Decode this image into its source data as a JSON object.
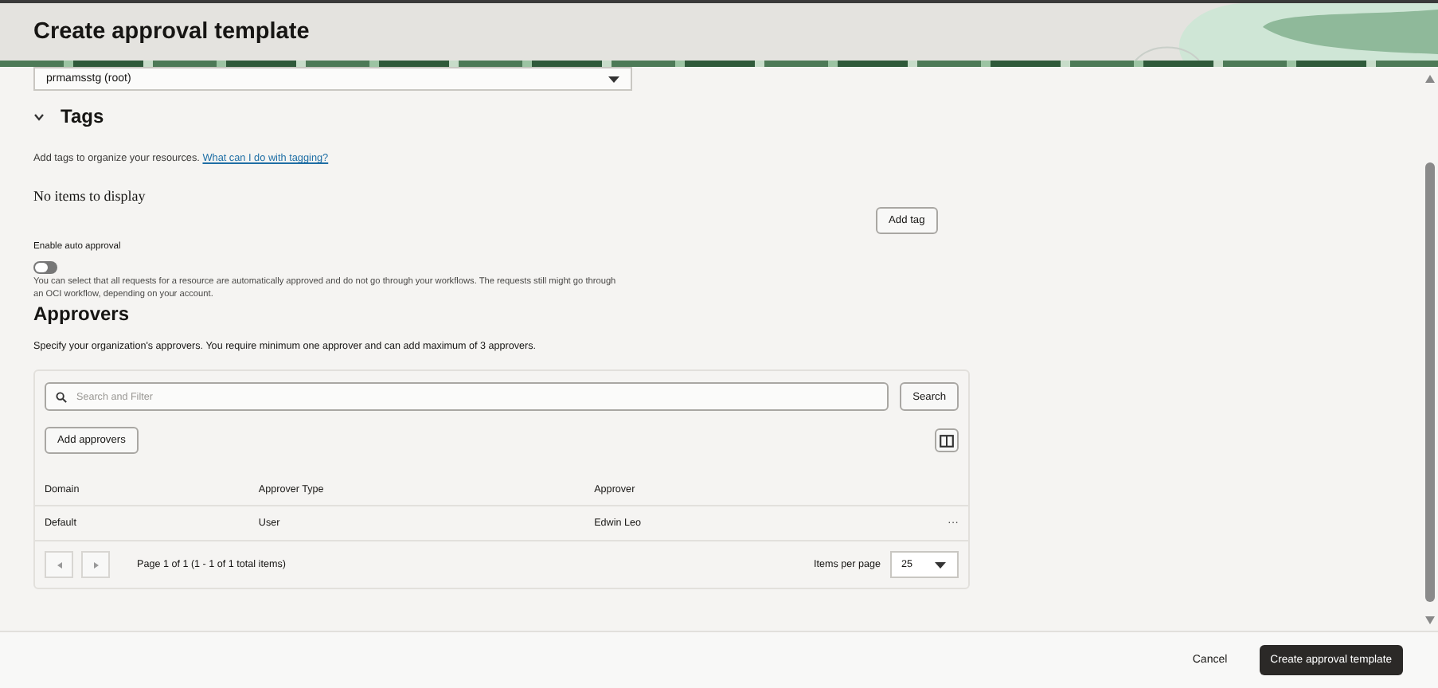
{
  "header": {
    "title": "Create approval template"
  },
  "compartment": {
    "value": "prmamsstg (root)"
  },
  "tags": {
    "title": "Tags",
    "expanded": true,
    "description": "Add tags to organize your resources.",
    "link": "What can I do with tagging?",
    "empty_text": "No items to display",
    "add_button": "Add tag"
  },
  "auto_approval": {
    "label": "Enable auto approval",
    "on": false,
    "help": "You can select that all requests for a resource are automatically approved and do not go through your workflows. The requests still might go through an OCI workflow, depending on your account."
  },
  "approvers": {
    "title": "Approvers",
    "description": "Specify your organization's approvers. You require minimum one approver and can add maximum of 3 approvers.",
    "search": {
      "placeholder": "Search and Filter"
    },
    "search_button": "Search",
    "add_button": "Add approvers",
    "table": {
      "columns": [
        "Domain",
        "Approver Type",
        "Approver"
      ],
      "rows": [
        {
          "cells": [
            "Default",
            "User",
            "Edwin Leo"
          ],
          "menu": "···"
        }
      ]
    },
    "pagination": {
      "summary": "Page 1 of 1 (1 - 1 of 1 total items)",
      "items_per_page_label": "Items per page",
      "items_per_page": "25"
    }
  },
  "footer": {
    "cancel": "Cancel",
    "submit": "Create approval template"
  }
}
